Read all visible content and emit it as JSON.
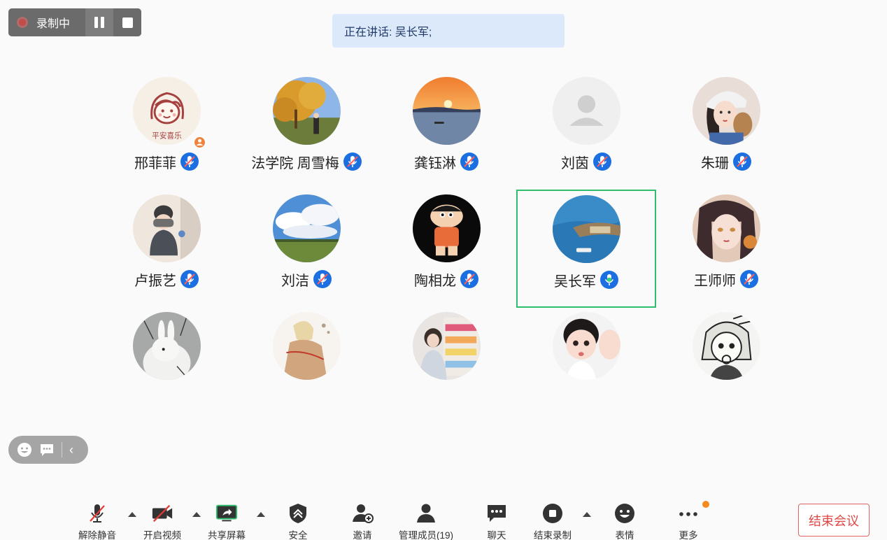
{
  "recording": {
    "label": "录制中"
  },
  "speaking_banner": "正在讲话: 吴长军;",
  "participants": [
    {
      "name": "邢菲菲"
    },
    {
      "name": "法学院 周雪梅"
    },
    {
      "name": "龚钰淋"
    },
    {
      "name": "刘茵"
    },
    {
      "name": "朱珊"
    },
    {
      "name": "卢振艺"
    },
    {
      "name": "刘洁"
    },
    {
      "name": "陶相龙"
    },
    {
      "name": "吴长军"
    },
    {
      "name": "王师师"
    },
    {
      "name": ""
    },
    {
      "name": ""
    },
    {
      "name": ""
    },
    {
      "name": ""
    },
    {
      "name": ""
    }
  ],
  "avatar_text": {
    "xing": "平安喜乐"
  },
  "toolbar": {
    "unmute": "解除静音",
    "video": "开启视频",
    "share": "共享屏幕",
    "security": "安全",
    "invite": "邀请",
    "members": "管理成员(19)",
    "chat": "聊天",
    "stop_record": "结束录制",
    "reactions": "表情",
    "more": "更多"
  },
  "end_meeting": "结束会议",
  "colors": {
    "accent_blue": "#1c6fe0",
    "active_border": "#2dbf6c",
    "end_red": "#e04747",
    "banner_bg": "#dce9fb",
    "badge_orange": "#f58a1f"
  }
}
